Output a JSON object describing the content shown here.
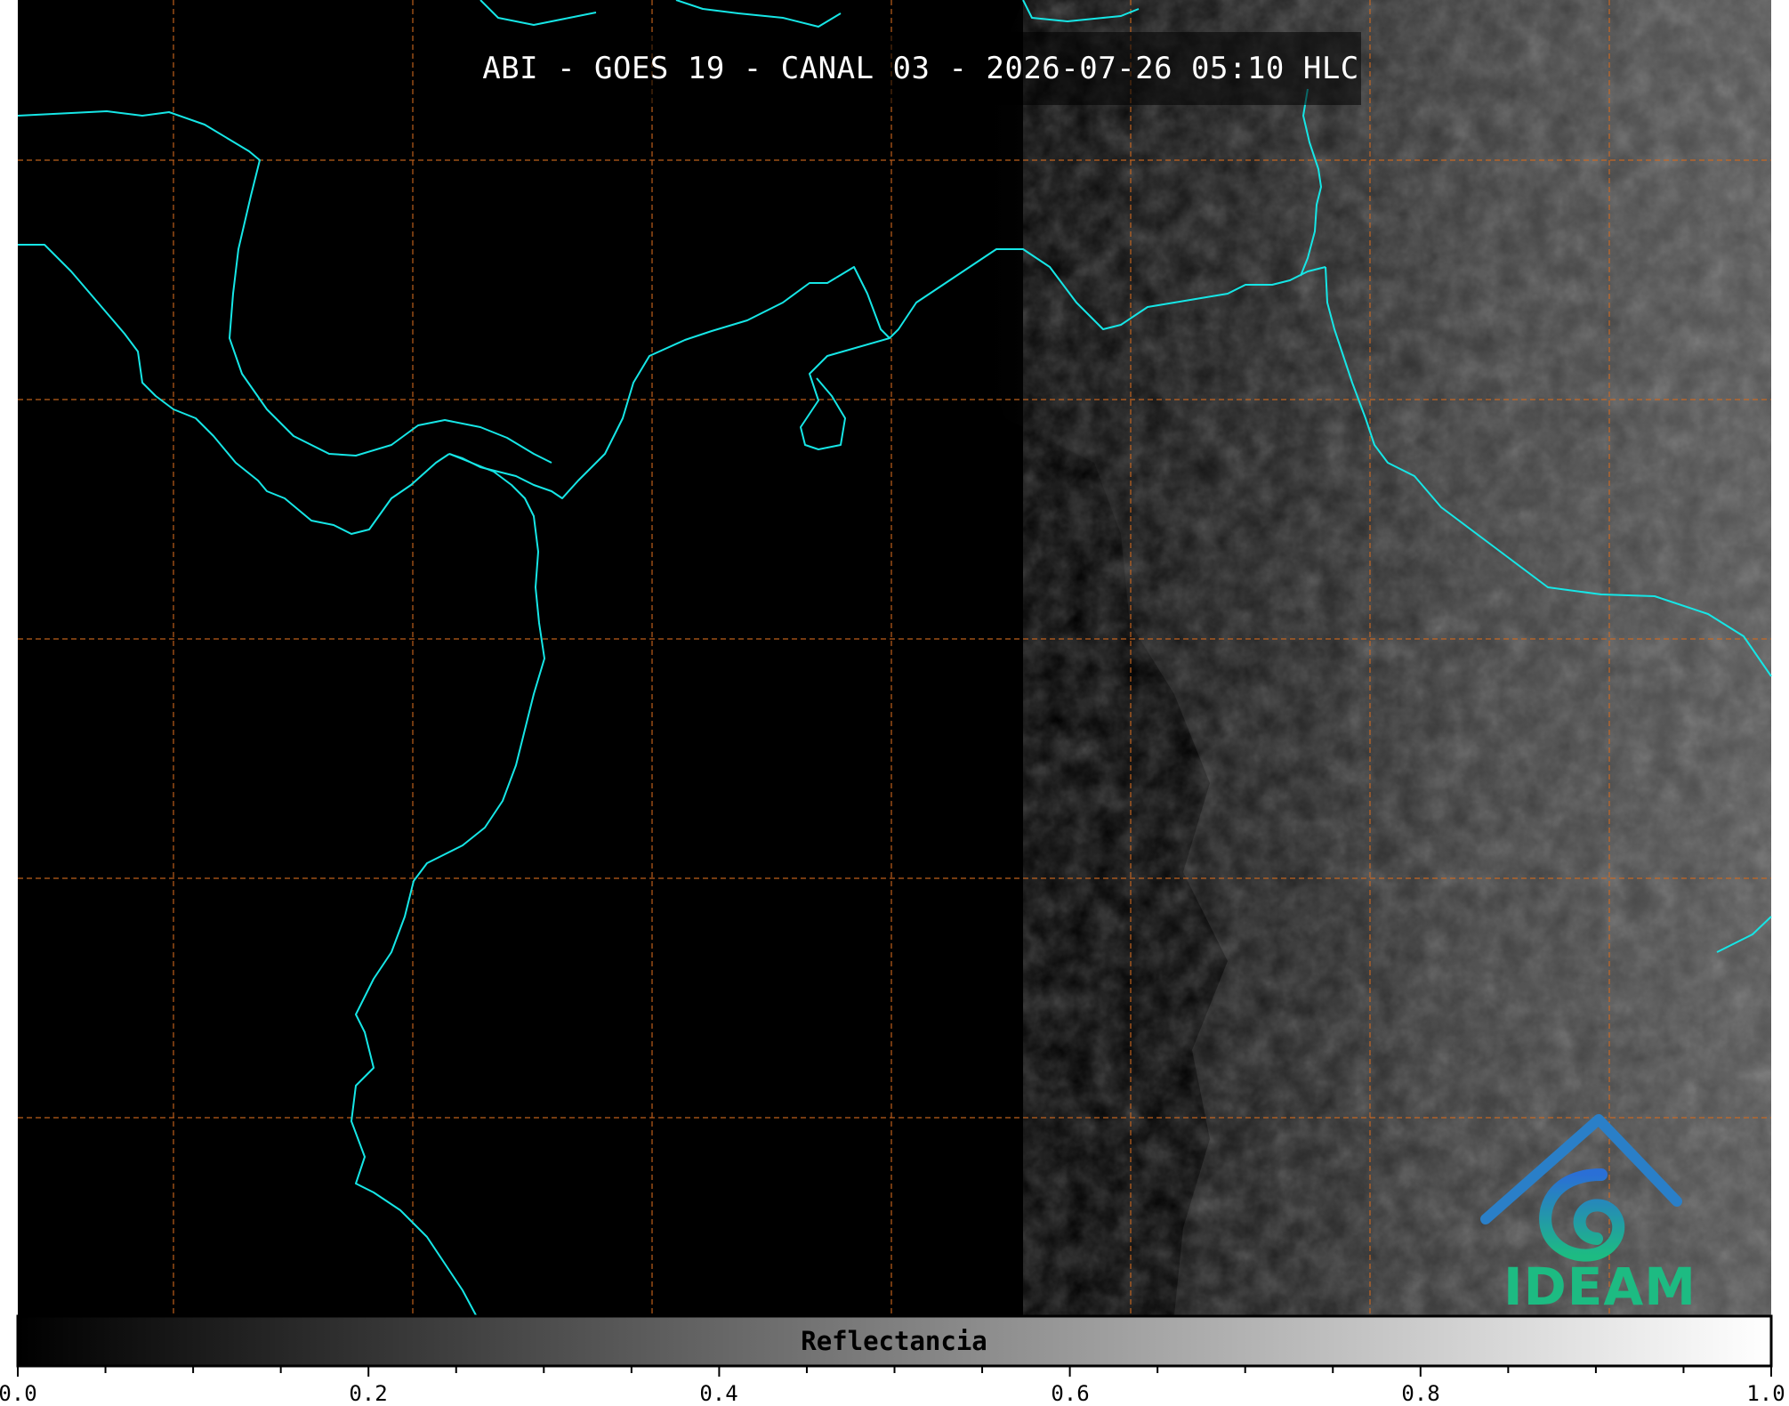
{
  "title": "ABI - GOES 19 - CANAL 03 - 2026-07-26 05:10 HLC",
  "colorbar": {
    "label": "Reflectancia",
    "ticks": [
      "0.0",
      "0.2",
      "0.4",
      "0.6",
      "0.8",
      "1.0"
    ],
    "range": [
      0.0,
      1.0
    ],
    "gradient_from": "#000000",
    "gradient_to": "#ffffff"
  },
  "logo": {
    "text": "IDEAM"
  },
  "colors": {
    "coastline": "#16e6e6",
    "gridlines": "#d2691e",
    "background": "#000000"
  },
  "map": {
    "gridlines": "dashed"
  }
}
